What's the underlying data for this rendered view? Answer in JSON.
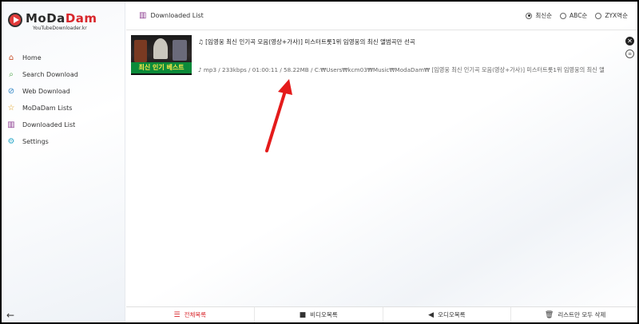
{
  "app": {
    "logo_title_main": "MoDa",
    "logo_title_accent": "Dam",
    "logo_subtitle": "YouTubeDownloader.kr"
  },
  "sidebar": {
    "items": [
      {
        "label": "Home",
        "icon": "home-icon"
      },
      {
        "label": "Search Download",
        "icon": "search-icon"
      },
      {
        "label": "Web Download",
        "icon": "globe-icon"
      },
      {
        "label": "MoDaDam Lists",
        "icon": "star-icon"
      },
      {
        "label": "Downloaded List",
        "icon": "library-icon"
      },
      {
        "label": "Settings",
        "icon": "gear-icon"
      }
    ],
    "back_glyph": "←"
  },
  "header": {
    "title": "Downloaded List",
    "sort_options": [
      {
        "label": "최신순",
        "checked": true
      },
      {
        "label": "ABC순",
        "checked": false
      },
      {
        "label": "ZYX역순",
        "checked": false
      }
    ]
  },
  "downloads": [
    {
      "title": "[임영웅 최신 인기곡 모음(영상+가사)] 미스터트롯1위 임영웅의 최신 앨범곡만 선곡",
      "meta": "mp3 / 233kbps / 01:00:11 / 58.22MB / C:₩Users₩kcm03₩Music₩ModaDam₩ [임영웅 최신 인기곡 모음(영상+가사)] 미스터트롯1위 임영웅의 최신 앨",
      "thumb_text": "최신 인기 베스트"
    }
  ],
  "footer": {
    "all_label": "전체목록",
    "video_label": "비디오목록",
    "audio_label": "오디오목록",
    "delete_label": "리스트만 모두 삭제"
  },
  "colors": {
    "accent_red": "#d8262b",
    "downloaded_purple": "#8b3a8f",
    "annotation_red": "#e41b1b"
  }
}
